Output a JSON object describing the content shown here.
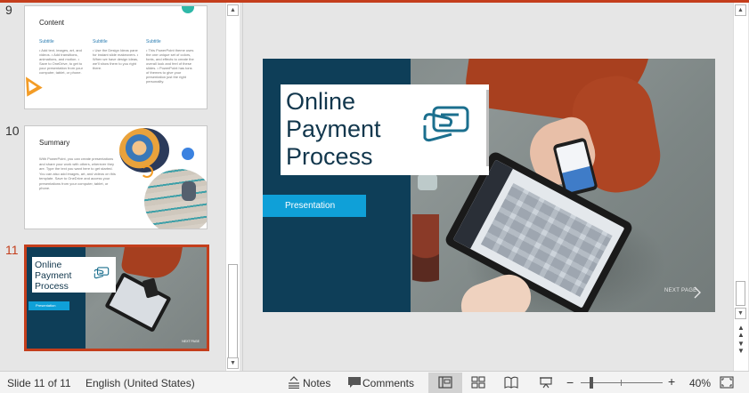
{
  "thumbnails": [
    {
      "number": "9",
      "title": "Content",
      "columns": [
        {
          "subtitle": "Subtitle",
          "text": "• Add text, images, art, and videos. • Add transitions, animations, and motion. • Save to OneDrive, to get to your presentation from your computer, tablet, or phone."
        },
        {
          "subtitle": "Subtitle",
          "text": "• Use the Design Ideas pane for instant slide makeovers. • When we have design ideas, we'll show them to you right there."
        },
        {
          "subtitle": "Subtitle",
          "text": "• This PowerPoint theme uses the one unique set of colors, fonts, and effects to create the overall look and feel of these slides. • PowerPoint has tons of themes to give your presentation just the right personality."
        }
      ]
    },
    {
      "number": "10",
      "title": "Summary",
      "body": "With PowerPoint, you can create presentations and share your work with others, wherever they are. Type the text you want here to get started. You can also add images, art, and videos on this template. Save to OneDrive and access your presentations from your computer, tablet, or phone."
    },
    {
      "number": "11",
      "title": "Online Payment Process",
      "button": "Presentation",
      "active": true
    }
  ],
  "slide": {
    "title_lines": [
      "Online",
      "Payment",
      "Process"
    ],
    "button_label": "Presentation",
    "next_label": "NEXT PAGE",
    "icon": "credit-card-hand-icon"
  },
  "status": {
    "slide_info": "Slide 11 of 11",
    "language": "English (United States)",
    "notes": "Notes",
    "comments": "Comments",
    "zoom": "40%",
    "icons": [
      "notes-icon",
      "comments-icon",
      "normal-view-icon",
      "slide-sorter-icon",
      "reading-view-icon",
      "slideshow-icon",
      "fit-to-window-icon"
    ]
  },
  "colors": {
    "accent": "#c43e1c",
    "slide_navy": "#0e3e58",
    "slide_cyan": "#0fa0d8",
    "title_text": "#12374d"
  }
}
